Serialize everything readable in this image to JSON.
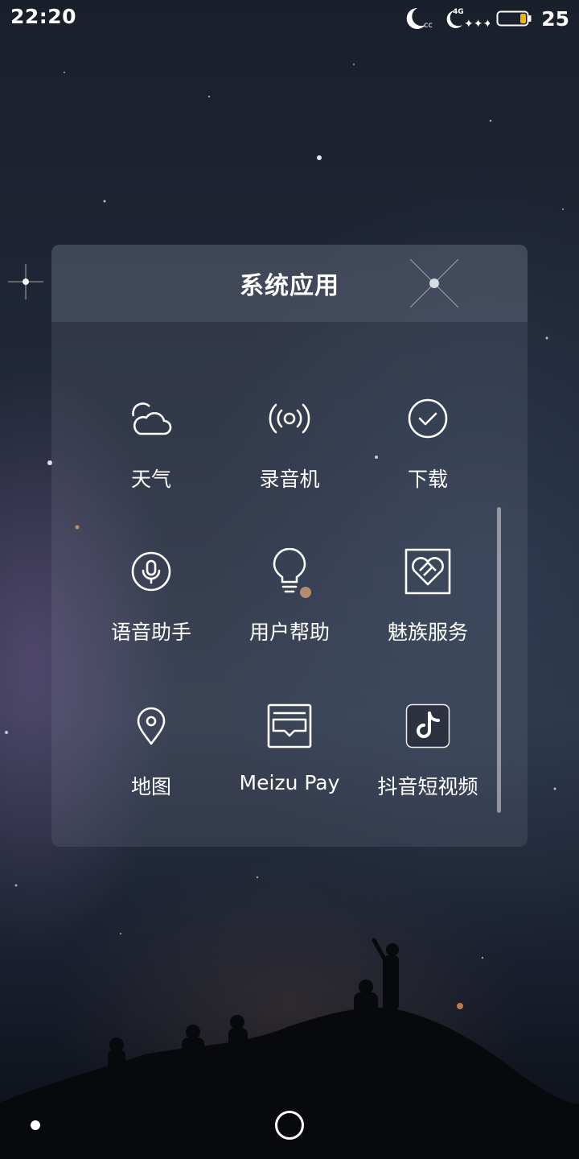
{
  "status_bar": {
    "time": "22:20",
    "network_label": "4G",
    "battery_level": "25",
    "icons": [
      "moon-icon",
      "moon-network-icon",
      "battery-icon"
    ]
  },
  "folder": {
    "title": "系统应用",
    "apps": [
      {
        "label": "天气",
        "icon": "weather-icon"
      },
      {
        "label": "录音机",
        "icon": "recorder-icon"
      },
      {
        "label": "下载",
        "icon": "download-icon"
      },
      {
        "label": "语音助手",
        "icon": "microphone-icon"
      },
      {
        "label": "用户帮助",
        "icon": "lightbulb-icon"
      },
      {
        "label": "魅族服务",
        "icon": "heart-icon"
      },
      {
        "label": "地图",
        "icon": "map-pin-icon"
      },
      {
        "label": "Meizu Pay",
        "icon": "wallet-icon"
      },
      {
        "label": "抖音短视频",
        "icon": "tiktok-icon"
      }
    ]
  },
  "nav_bar": {
    "icons": [
      "nav-dot-icon",
      "home-circle-icon"
    ]
  },
  "colors": {
    "text": "#ffffff",
    "battery_fill": "#f5b400"
  }
}
